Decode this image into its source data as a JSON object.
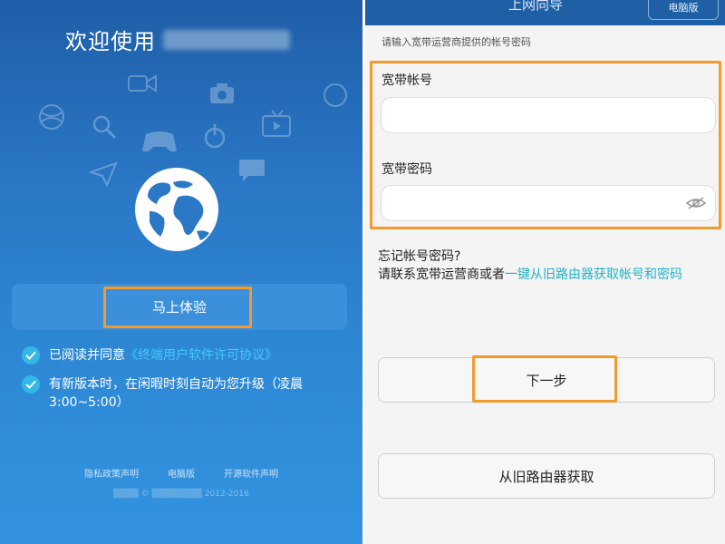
{
  "left": {
    "welcome": "欢迎使用",
    "experience_button": "马上体验",
    "agree_prefix": "已阅读并同意",
    "agree_link": "《终端用户软件许可协议》",
    "auto_update": "有新版本时，在闲暇时刻自动为您升级（凌晨3:00~5:00）",
    "footer": {
      "privacy": "隐私政策声明",
      "pc": "电脑版",
      "opensource": "开源软件声明"
    }
  },
  "right": {
    "title": "上网向导",
    "pc_button": "电脑版",
    "hint": "请输入宽带运营商提供的帐号密码",
    "account_label": "宽带帐号",
    "account_value": "",
    "password_label": "宽带密码",
    "password_value": "",
    "forgot_title": "忘记帐号密码?",
    "forgot_text": "请联系宽带运营商或者",
    "forgot_link": "一键从旧路由器获取帐号和密码",
    "next_button": "下一步",
    "old_router_button": "从旧路由器获取"
  },
  "colors": {
    "accent_orange": "#f39a2c",
    "link_teal": "#1fb3c7",
    "link_blue": "#44c8ff",
    "check": "#33b6e8"
  }
}
